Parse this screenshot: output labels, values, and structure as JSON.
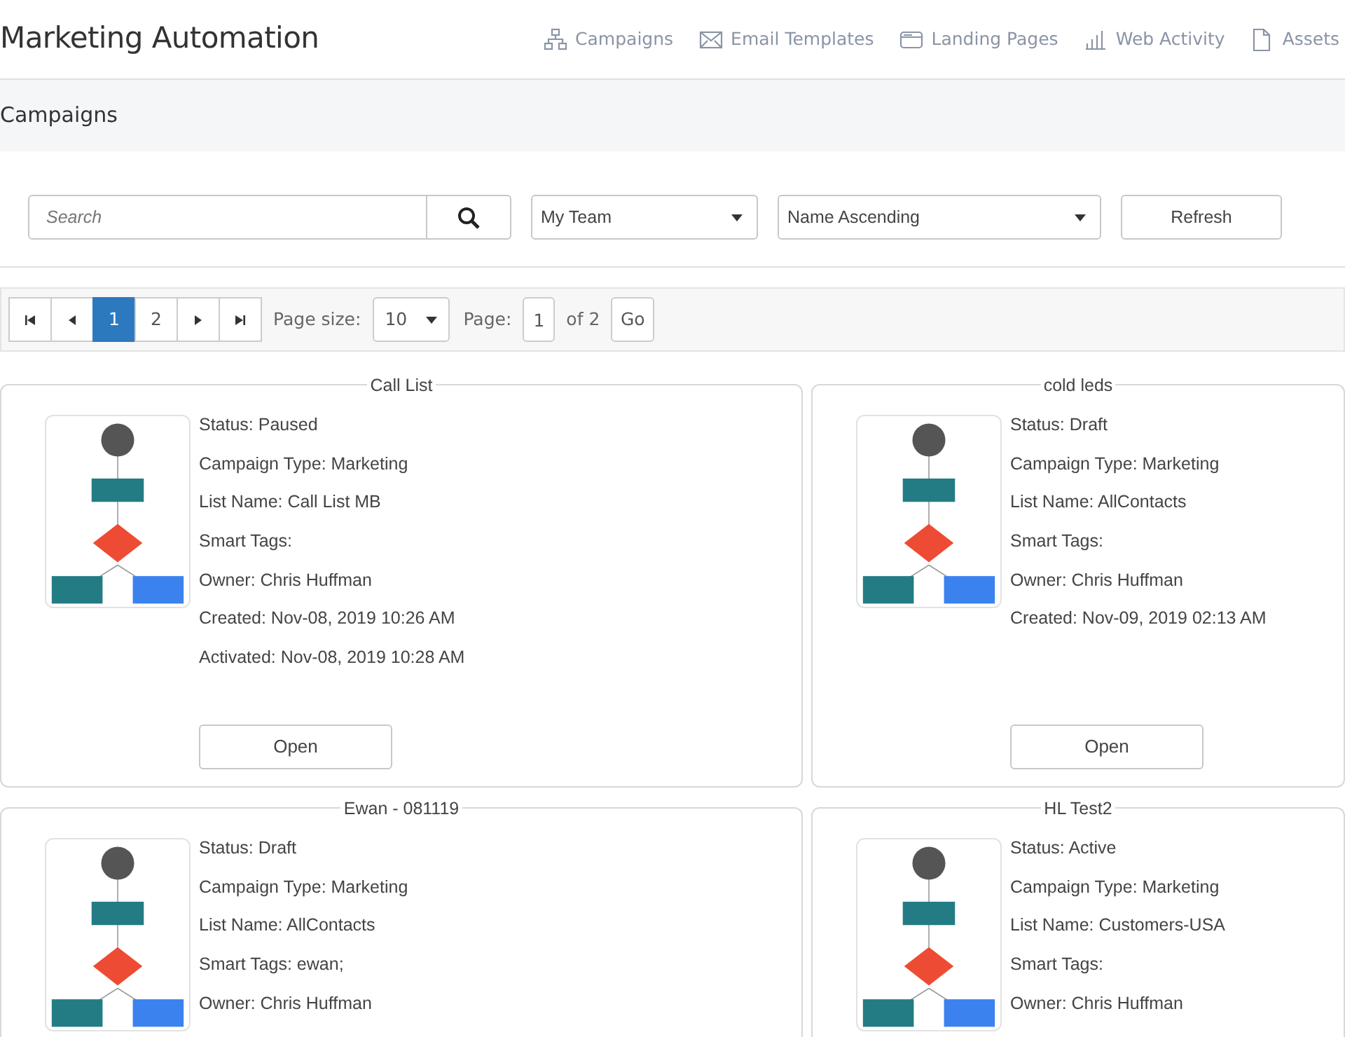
{
  "header": {
    "title": "Marketing Automation",
    "nav": [
      {
        "label": "Campaigns"
      },
      {
        "label": "Email Templates"
      },
      {
        "label": "Landing Pages"
      },
      {
        "label": "Web Activity"
      },
      {
        "label": "Assets"
      }
    ]
  },
  "page_title": "Campaigns",
  "toolbar": {
    "search": {
      "placeholder": "Search"
    },
    "team_filter": "My Team",
    "sort": "Name Ascending",
    "refresh": "Refresh"
  },
  "pager": {
    "pages": [
      {
        "label": "1",
        "selected": true
      },
      {
        "label": "2",
        "selected": false
      }
    ],
    "page_size_label": "Page size:",
    "page_size": "10",
    "page_label": "Page:",
    "page": "1",
    "page_total": "of 2",
    "go": "Go"
  },
  "campaigns": [
    {
      "name": "Call List",
      "details": [
        "Status: Paused",
        "Campaign Type: Marketing",
        "List Name: Call List MB",
        "Smart Tags:",
        "Owner: Chris Huffman",
        "Created: Nov-08, 2019 10:26 AM",
        "Activated: Nov-08, 2019 10:28 AM"
      ],
      "open": "Open"
    },
    {
      "name": "cold leds",
      "details": [
        "Status: Draft",
        "Campaign Type: Marketing",
        "List Name: AllContacts",
        "Smart Tags:",
        "Owner: Chris Huffman",
        "Created: Nov-09, 2019 02:13 AM"
      ],
      "open": "Open"
    },
    {
      "name": "Ewan - 081119",
      "details": [
        "Status: Draft",
        "Campaign Type: Marketing",
        "List Name: AllContacts",
        "Smart Tags: ewan;",
        "Owner: Chris Huffman"
      ]
    },
    {
      "name": "HL Test2",
      "details": [
        "Status: Active",
        "Campaign Type: Marketing",
        "List Name: Customers-USA",
        "Smart Tags:",
        "Owner: Chris Huffman"
      ]
    }
  ]
}
